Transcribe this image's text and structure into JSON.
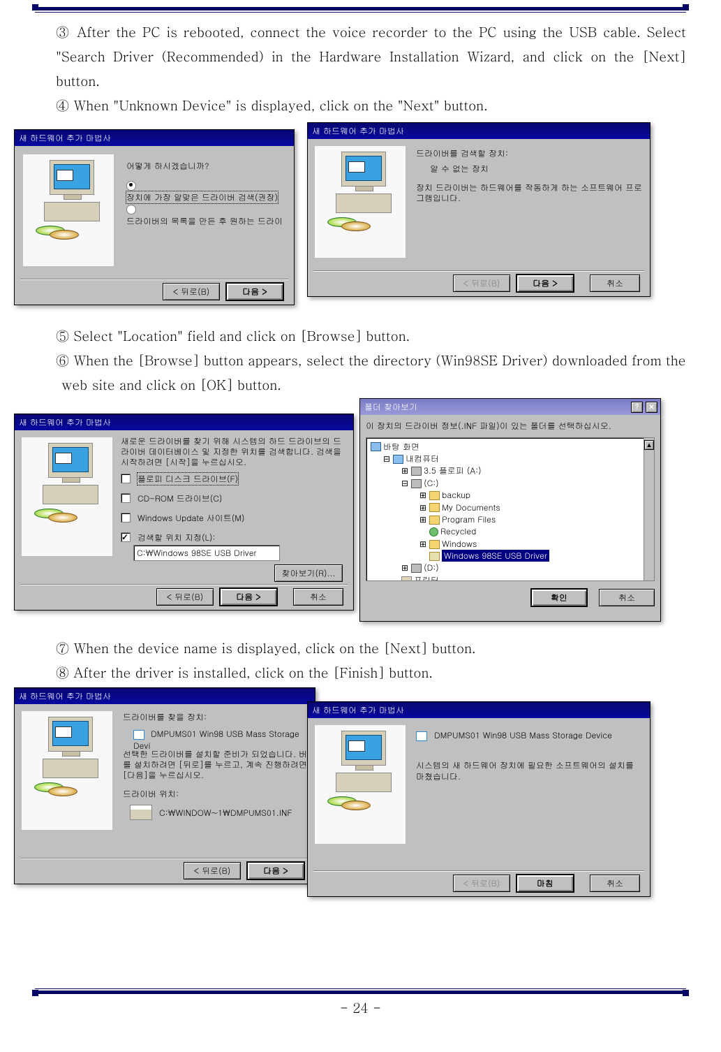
{
  "page_number": "- 24 -",
  "paragraphs": {
    "p3": "③ After the PC is rebooted, connect the voice recorder to the PC using the USB cable.   Select \"Search Driver (Recommended) in the Hardware Installation Wizard, and click on the [Next] button.",
    "p4": "④ When \"Unknown Device\" is displayed, click on the \"Next\" button.",
    "p5": "⑤ Select \"Location\" field and click on [Browse] button.",
    "p6": "⑥ When the [Browse] button appears, select the directory (Win98SE Driver) downloaded from the",
    "p6b": "web site and click on [OK] button.",
    "p7": "⑦ When the device name is displayed, click on the [Next] button.",
    "p8": "⑧ After the driver is installed, click on the [Finish] button."
  },
  "dialog1": {
    "title": "새 하드웨어 추가 마법사",
    "q": "어떻게 하시겠습니까?",
    "opt1": "장치에 가장 알맞은 드라이버 검색(권장)",
    "opt2": "드라이버의 목록을 만든 후 원하는 드라이",
    "btn_back": "< 뒤로(B)",
    "btn_next": "다음 >"
  },
  "dialog2": {
    "title": "새 하드웨어 추가 마법사",
    "line1": "드라이버를 검색할 장치:",
    "line2": "알 수 없는 장치",
    "line3": "장치 드라이버는 하드웨어를 작동하게 하는 소프트웨어 프로그램입니다.",
    "btn_back": "< 뒤로(B)",
    "btn_next": "다음 >",
    "btn_cancel": "취소"
  },
  "dialog3": {
    "title": "새 하드웨어 추가 마법사",
    "intro": "새로운 드라이버를 찾기 위해 시스템의 하드 드라이브의 드라이버 데이터베이스 및 지정한 위치를 검색합니다. 검색을 시작하려면 [시작]을 누르십시오.",
    "opt_fd": "플로피 디스크 드라이브(F)",
    "opt_cd": "CD-ROM 드라이브(C)",
    "opt_wu": "Windows Update 사이트(M)",
    "opt_loc": "검색할 위치 지정(L):",
    "path": "C:\\Windows 98SE USB Driver",
    "btn_browse": "찾아보기(R)...",
    "btn_back": "< 뒤로(B)",
    "btn_next": "다음 >",
    "btn_cancel": "취소"
  },
  "dialog_browse": {
    "title": "폴더 찾아보기",
    "instr": "이 장치의 드라이버 정보(.INF 파일)이 있는 폴더를 선택하십시오.",
    "tree": {
      "desktop": "바탕 화면",
      "mycomp": "내컴퓨터",
      "floppy": "3.5 플로피 (A:)",
      "c": "(C:)",
      "backup": "backup",
      "docs": "My Documents",
      "pf": "Program Files",
      "rec": "Recycled",
      "win": "Windows",
      "driver": "Windows 98SE USB Driver",
      "d": "(D:)",
      "printer": "프린터"
    },
    "btn_ok": "확인",
    "btn_cancel": "취소"
  },
  "dialog5": {
    "title": "새 하드웨어 추가 마법사",
    "line1": "드라이버를 찾을 장치:",
    "device": "DMPUMS01 Win98 USB Mass Storage Devi",
    "line2": "선택한 드라이버를 설치할 준비가 되었습니다. 버를 설치하려면 [뒤로]를 누르고, 계속 진행하려면 [다음]을 누르십시오.",
    "line3": "드라이버 위치:",
    "path": "C:\\WINDOW~1\\DMPUMS01.INF",
    "btn_back": "< 뒤로(B)",
    "btn_next": "다음 >"
  },
  "dialog6": {
    "title": "새 하드웨어 추가 마법사",
    "device": "DMPUMS01 Win98 USB Mass Storage Device",
    "line": "시스템의 새 하드웨어 장치에 필요한 소프트웨어의 설치를 마쳤습니다.",
    "btn_back": "< 뒤로(B)",
    "btn_finish": "마침",
    "btn_cancel": "취소"
  }
}
